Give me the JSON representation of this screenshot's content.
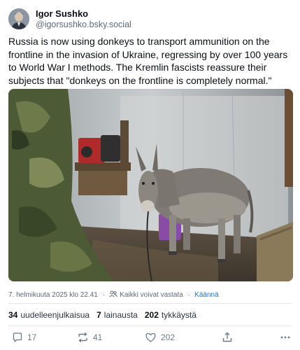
{
  "post": {
    "author": {
      "display_name": "Igor Sushko",
      "handle": "@igorsushko.bsky.social"
    },
    "text": "Russia is now using donkeys to transport ammunition on the frontline in the invasion of Ukraine, regressing by over 100 years to World War I methods.  The Kremlin fascists reassure their subjects that \"donkeys on the frontline is completely normal.\"",
    "timestamp": "7. helmikuuta 2025 klo 22.41",
    "reply_permission": "Kaikki voivat vastata",
    "translate_label": "Käännä",
    "stats": {
      "reposts_count": "34",
      "reposts_label": "uudelleenjulkaisua",
      "quotes_count": "7",
      "quotes_label": "lainausta",
      "likes_count": "202",
      "likes_label": "tykkäystä"
    },
    "actions": {
      "replies": "17",
      "reposts": "41",
      "likes": "202"
    }
  },
  "colors": {
    "text_primary": "#0b0f14",
    "text_secondary": "#5b6b7c",
    "link": "#1d73e8",
    "divider": "#e3e8ee"
  }
}
